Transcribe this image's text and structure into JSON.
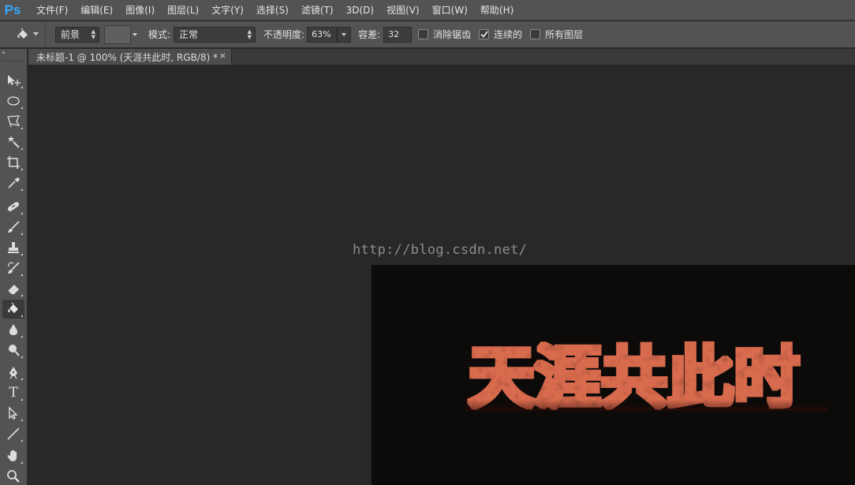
{
  "app": {
    "logo": "Ps"
  },
  "menu": [
    "文件(F)",
    "编辑(E)",
    "图像(I)",
    "图层(L)",
    "文字(Y)",
    "选择(S)",
    "滤镜(T)",
    "3D(D)",
    "视图(V)",
    "窗口(W)",
    "帮助(H)"
  ],
  "options": {
    "tool_icon": "paint-bucket-icon",
    "fill_source": "前景",
    "mode_label": "模式:",
    "mode_value": "正常",
    "opacity_label": "不透明度:",
    "opacity_value": "63%",
    "tolerance_label": "容差:",
    "tolerance_value": "32",
    "antialias_label": "消除锯齿",
    "antialias_checked": false,
    "contiguous_label": "连续的",
    "contiguous_checked": true,
    "all_layers_label": "所有图层",
    "all_layers_checked": false
  },
  "document": {
    "tab_title": "未标题-1 @ 100% (天涯共此时, RGB/8) *",
    "close_glyph": "×",
    "watermark": "http://blog.csdn.net/",
    "art_text": "天涯共此时",
    "art_color": "#d86a4e",
    "background_color": "#0d0b0a"
  },
  "toolbox": {
    "collapse_glyph": "»",
    "tools": [
      "move-icon",
      "elliptical-marquee-icon",
      "polygonal-lasso-icon",
      "magic-wand-icon",
      "crop-icon",
      "eyedropper-icon",
      "healing-brush-icon",
      "brush-icon",
      "clone-stamp-icon",
      "history-brush-icon",
      "eraser-icon",
      "paint-bucket-icon",
      "blur-icon",
      "dodge-icon",
      "pen-icon",
      "type-icon",
      "path-selection-icon",
      "line-icon",
      "hand-icon",
      "zoom-icon"
    ],
    "active": "paint-bucket-icon",
    "type_glyph": "T"
  }
}
